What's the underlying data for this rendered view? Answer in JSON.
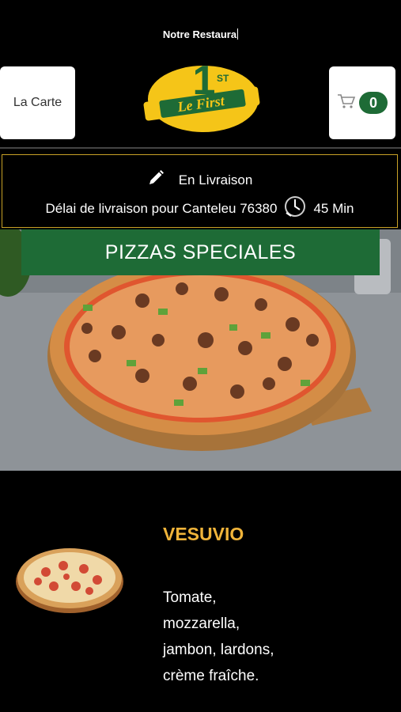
{
  "header": {
    "marquee_text": "Notre Restaura",
    "menu_button": "La Carte",
    "cart_count": "0",
    "logo": {
      "text": "Le First",
      "number": "1",
      "superscript": "ST",
      "color_yellow": "#f5c518",
      "color_green": "#1e6b36"
    }
  },
  "delivery": {
    "mode": "En Livraison",
    "delay_label": "Délai de livraison pour Canteleu 76380",
    "delay_time": "45 Min",
    "border_color": "#c9a227"
  },
  "category": {
    "title": "PIZZAS SPECIALES",
    "color": "#1e6b36"
  },
  "product": {
    "name": "VESUVIO",
    "description": "Tomate,\nmozzarella,\njambon, lardons,\ncrème fraîche.",
    "name_color": "#f0b43a"
  }
}
